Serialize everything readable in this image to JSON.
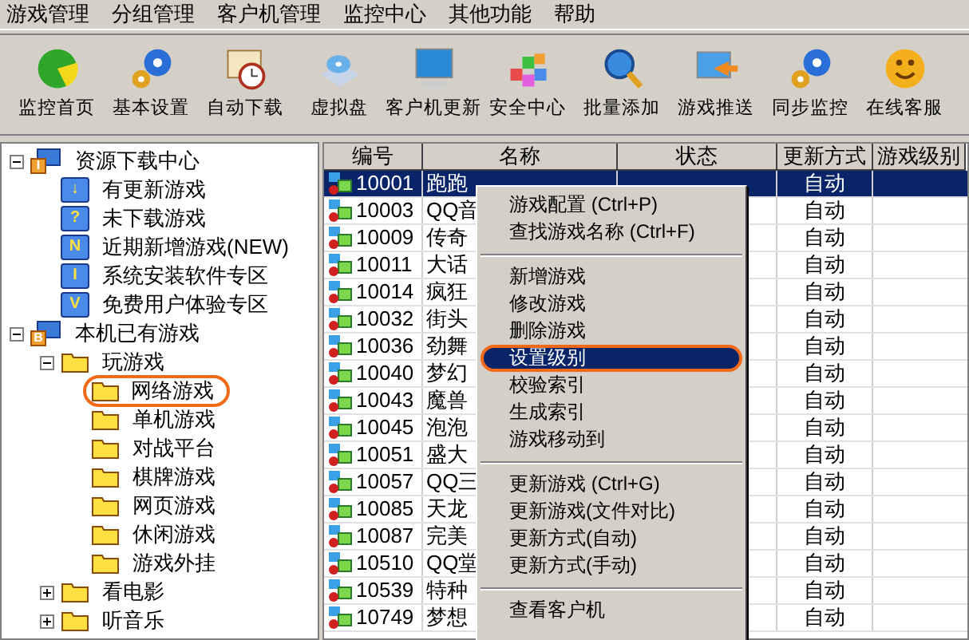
{
  "menubar": [
    "游戏管理",
    "分组管理",
    "客户机管理",
    "监控中心",
    "其他功能",
    "帮助"
  ],
  "toolbar": [
    {
      "label": "监控首页"
    },
    {
      "label": "基本设置"
    },
    {
      "label": "自动下载"
    },
    {
      "label": "虚拟盘"
    },
    {
      "label": "客户机更新"
    },
    {
      "label": "安全中心"
    },
    {
      "label": "批量添加"
    },
    {
      "label": "游戏推送"
    },
    {
      "label": "同步监控"
    },
    {
      "label": "在线客服"
    }
  ],
  "tree": [
    {
      "label": "资源下载中心",
      "kind": "group",
      "badge": "I",
      "expanded": true,
      "circled": false,
      "children": [
        {
          "label": "有更新游戏",
          "kind": "category",
          "badge": "↓",
          "circled": false
        },
        {
          "label": "未下载游戏",
          "kind": "category",
          "badge": "?",
          "circled": false
        },
        {
          "label": "近期新增游戏(NEW)",
          "kind": "category",
          "badge": "N",
          "circled": false
        },
        {
          "label": "系统安装软件专区",
          "kind": "category",
          "badge": "I",
          "circled": false
        },
        {
          "label": "免费用户体验专区",
          "kind": "category",
          "badge": "V",
          "circled": false
        }
      ]
    },
    {
      "label": "本机已有游戏",
      "kind": "group",
      "badge": "B",
      "expanded": true,
      "circled": false,
      "children": [
        {
          "label": "玩游戏",
          "kind": "folder",
          "expanded": true,
          "circled": false,
          "children": [
            {
              "label": "网络游戏",
              "kind": "folder",
              "circled": true
            },
            {
              "label": "单机游戏",
              "kind": "folder",
              "circled": false
            },
            {
              "label": "对战平台",
              "kind": "folder",
              "circled": false
            },
            {
              "label": "棋牌游戏",
              "kind": "folder",
              "circled": false
            },
            {
              "label": "网页游戏",
              "kind": "folder",
              "circled": false
            },
            {
              "label": "休闲游戏",
              "kind": "folder",
              "circled": false
            },
            {
              "label": "游戏外挂",
              "kind": "folder",
              "circled": false
            }
          ]
        },
        {
          "label": "看电影",
          "kind": "folder",
          "expanded": false,
          "circled": false
        },
        {
          "label": "听音乐",
          "kind": "folder",
          "expanded": false,
          "circled": false
        }
      ]
    }
  ],
  "table": {
    "columns": [
      "编号",
      "名称",
      "状态",
      "更新方式",
      "游戏级别"
    ],
    "rows": [
      {
        "id": "10001",
        "name": "跑跑",
        "update": "自动",
        "selected": true
      },
      {
        "id": "10003",
        "name": "QQ音",
        "update": "自动",
        "selected": false
      },
      {
        "id": "10009",
        "name": "传奇",
        "update": "自动",
        "selected": false
      },
      {
        "id": "10011",
        "name": "大话",
        "update": "自动",
        "selected": false
      },
      {
        "id": "10014",
        "name": "疯狂",
        "update": "自动",
        "selected": false
      },
      {
        "id": "10032",
        "name": "街头",
        "update": "自动",
        "selected": false
      },
      {
        "id": "10036",
        "name": "劲舞",
        "update": "自动",
        "selected": false
      },
      {
        "id": "10040",
        "name": "梦幻",
        "update": "自动",
        "selected": false
      },
      {
        "id": "10043",
        "name": "魔兽",
        "update": "自动",
        "selected": false
      },
      {
        "id": "10045",
        "name": "泡泡",
        "update": "自动",
        "selected": false
      },
      {
        "id": "10051",
        "name": "盛大",
        "update": "自动",
        "selected": false
      },
      {
        "id": "10057",
        "name": "QQ三",
        "update": "自动",
        "selected": false
      },
      {
        "id": "10085",
        "name": "天龙",
        "update": "自动",
        "selected": false
      },
      {
        "id": "10087",
        "name": "完美",
        "update": "自动",
        "selected": false
      },
      {
        "id": "10510",
        "name": "QQ堂",
        "update": "自动",
        "selected": false
      },
      {
        "id": "10539",
        "name": "特种",
        "update": "自动",
        "selected": false
      },
      {
        "id": "10749",
        "name": "梦想",
        "update": "自动",
        "selected": false
      }
    ]
  },
  "context_menu": [
    {
      "kind": "item",
      "label": "游戏配置 (Ctrl+P)",
      "selected": false,
      "circled": false
    },
    {
      "kind": "item",
      "label": "查找游戏名称 (Ctrl+F)",
      "selected": false,
      "circled": false
    },
    {
      "kind": "separator"
    },
    {
      "kind": "item",
      "label": "新增游戏",
      "selected": false,
      "circled": false
    },
    {
      "kind": "item",
      "label": "修改游戏",
      "selected": false,
      "circled": false
    },
    {
      "kind": "item",
      "label": "删除游戏",
      "selected": false,
      "circled": false
    },
    {
      "kind": "item",
      "label": "设置级别",
      "selected": true,
      "circled": true
    },
    {
      "kind": "item",
      "label": "校验索引",
      "selected": false,
      "circled": false
    },
    {
      "kind": "item",
      "label": "生成索引",
      "selected": false,
      "circled": false
    },
    {
      "kind": "item",
      "label": "游戏移动到",
      "selected": false,
      "circled": false
    },
    {
      "kind": "separator"
    },
    {
      "kind": "item",
      "label": "更新游戏 (Ctrl+G)",
      "selected": false,
      "circled": false
    },
    {
      "kind": "item",
      "label": "更新游戏(文件对比)",
      "selected": false,
      "circled": false
    },
    {
      "kind": "item",
      "label": "更新方式(自动)",
      "selected": false,
      "circled": false
    },
    {
      "kind": "item",
      "label": "更新方式(手动)",
      "selected": false,
      "circled": false
    },
    {
      "kind": "separator"
    },
    {
      "kind": "item",
      "label": "查看客户机",
      "selected": false,
      "circled": false
    }
  ]
}
